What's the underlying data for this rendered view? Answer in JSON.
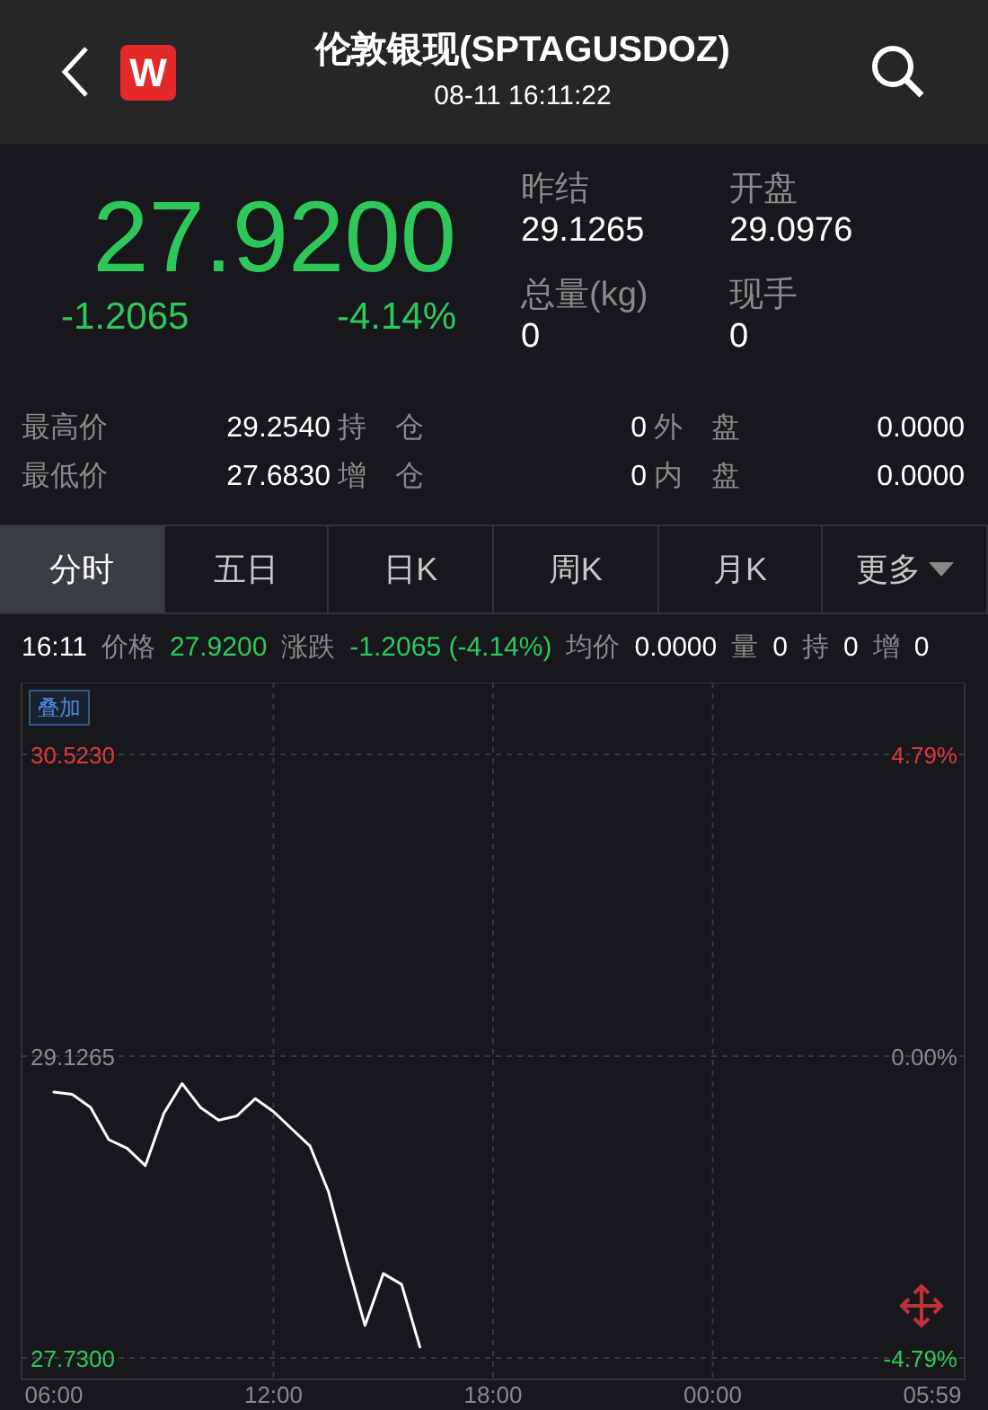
{
  "header": {
    "logo": "W",
    "title": "伦敦银现(SPTAGUSDOZ)",
    "time": "08-11 16:11:22"
  },
  "quote": {
    "price": "27.9200",
    "change": "-1.2065",
    "change_pct": "-4.14%",
    "falling": true,
    "fields": [
      {
        "label": "昨结",
        "value": "29.1265"
      },
      {
        "label": "开盘",
        "value": "29.0976"
      },
      {
        "label": "总量(kg)",
        "value": "0"
      },
      {
        "label": "现手",
        "value": "0"
      }
    ]
  },
  "stats": [
    {
      "label": "最高价",
      "value": "29.2540"
    },
    {
      "label": "持　仓",
      "value": "0"
    },
    {
      "label": "外　盘",
      "value": "0.0000"
    },
    {
      "label": "最低价",
      "value": "27.6830"
    },
    {
      "label": "增　仓",
      "value": "0"
    },
    {
      "label": "内　盘",
      "value": "0.0000"
    }
  ],
  "tabs": [
    {
      "label": "分时",
      "selected": true,
      "kind": "tab"
    },
    {
      "label": "五日",
      "selected": false,
      "kind": "tab"
    },
    {
      "label": "日K",
      "selected": false,
      "kind": "tab"
    },
    {
      "label": "周K",
      "selected": false,
      "kind": "tab"
    },
    {
      "label": "月K",
      "selected": false,
      "kind": "tab"
    },
    {
      "label": "更多",
      "selected": false,
      "kind": "menu"
    }
  ],
  "info_line": {
    "time": "16:11",
    "items": [
      {
        "label": "价格",
        "value": "27.9200",
        "color": "#2ec85a"
      },
      {
        "label": "涨跌",
        "value": "-1.2065 (-4.14%)",
        "color": "#2ec85a"
      },
      {
        "label": "均价",
        "value": "0.0000",
        "color": "#ffffff"
      },
      {
        "label": "量",
        "value": "0",
        "color": "#ffffff"
      },
      {
        "label": "持",
        "value": "0",
        "color": "#ffffff"
      },
      {
        "label": "增",
        "value": "0",
        "color": "#ffffff"
      }
    ]
  },
  "overlay_button": "叠加",
  "percent_labels": [
    {
      "text": "4.79%",
      "color": "#e0383e"
    },
    {
      "text": "0.00%",
      "color": "#8a8a8a"
    },
    {
      "text": "-4.79%",
      "color": "#2ec85a"
    }
  ],
  "chart_data": {
    "type": "line",
    "categories": [
      "06:00",
      null,
      null,
      null,
      null,
      null,
      null,
      null,
      null,
      null,
      null,
      null,
      "12:00",
      null,
      null,
      null,
      null,
      null,
      null,
      null,
      null,
      null,
      null,
      null,
      "18:00",
      null,
      null,
      null,
      null,
      null,
      null,
      null,
      null,
      null,
      null,
      null,
      "00:00",
      null,
      null,
      null,
      null,
      null,
      null,
      null,
      null,
      null,
      null,
      null,
      "05:59"
    ],
    "series": [
      {
        "color": "#ffffff",
        "values": [
          28.96,
          28.95,
          28.89,
          28.74,
          28.7,
          28.62,
          28.86,
          29.0,
          28.89,
          28.83,
          28.85,
          28.93,
          28.87,
          28.79,
          28.71,
          28.5,
          28.18,
          27.88,
          28.12,
          28.07,
          27.78,
          null,
          null,
          null,
          null,
          null,
          null,
          null,
          null,
          null,
          null,
          null,
          null,
          null,
          null,
          null,
          null,
          null,
          null,
          null,
          null,
          null,
          null,
          null,
          null,
          null,
          null,
          null,
          null
        ]
      }
    ],
    "ylim": [
      27.63,
      30.856
    ],
    "grid": true,
    "yticks": [
      {
        "value": 30.523,
        "label": "30.5230"
      },
      {
        "value": 29.1265,
        "label": "29.1265"
      },
      {
        "value": 27.73,
        "label": "27.7300"
      }
    ]
  }
}
